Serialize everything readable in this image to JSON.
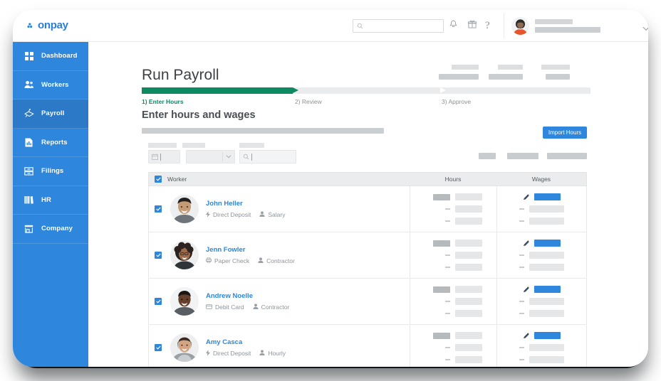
{
  "brand": {
    "name": "onpay",
    "color": "#2e86dd"
  },
  "topbar": {
    "search": {
      "placeholder": "",
      "value": ""
    },
    "icons": [
      {
        "name": "bell-icon",
        "label": "Notifications"
      },
      {
        "name": "gift-icon",
        "label": "What's New"
      },
      {
        "name": "help-icon",
        "label": "?"
      }
    ],
    "user_menu": {
      "caret": "chevron-down-icon"
    }
  },
  "sidebar": {
    "items": [
      {
        "label": "Dashboard",
        "icon": "grid-icon",
        "active": false
      },
      {
        "label": "Workers",
        "icon": "people-icon",
        "active": false
      },
      {
        "label": "Payroll",
        "icon": "money-icon",
        "active": true
      },
      {
        "label": "Reports",
        "icon": "document-icon",
        "active": false
      },
      {
        "label": "Filings",
        "icon": "drawer-icon",
        "active": false
      },
      {
        "label": "HR",
        "icon": "books-icon",
        "active": false
      },
      {
        "label": "Company",
        "icon": "store-icon",
        "active": false
      }
    ]
  },
  "main": {
    "title": "Run Payroll",
    "steps": [
      {
        "label": "1) Enter Hours",
        "state": "active"
      },
      {
        "label": "2) Review",
        "state": "upcoming"
      },
      {
        "label": "3) Approve",
        "state": "upcoming"
      }
    ],
    "progress_percent": 34,
    "progress_color": "#0d8a62",
    "section_title": "Enter hours and wages",
    "import_button": "Import Hours",
    "filters": {
      "date": {
        "icon": "calendar-icon",
        "value": ""
      },
      "select": {
        "value": "",
        "caret": "chevron-down-icon"
      },
      "search": {
        "icon": "search-icon",
        "value": ""
      }
    }
  },
  "table": {
    "columns": {
      "worker": "Worker",
      "hours": "Hours",
      "wages": "Wages"
    },
    "select_all_checked": true,
    "rows": [
      {
        "name": "John Heller",
        "pay_method": "Direct Deposit",
        "pay_method_icon": "lightning-icon",
        "pay_type": "Salary",
        "pay_type_icon": "person-icon",
        "selected": true,
        "avatar": "avatar-john"
      },
      {
        "name": "Jenn Fowler",
        "pay_method": "Paper Check",
        "pay_method_icon": "printer-icon",
        "pay_type": "Contractor",
        "pay_type_icon": "person-icon",
        "selected": true,
        "avatar": "avatar-jenn"
      },
      {
        "name": "Andrew Noelle",
        "pay_method": "Debit Card",
        "pay_method_icon": "card-icon",
        "pay_type": "Contractor",
        "pay_type_icon": "person-icon",
        "selected": true,
        "avatar": "avatar-andrew"
      },
      {
        "name": "Amy Casca",
        "pay_method": "Direct Deposit",
        "pay_method_icon": "lightning-icon",
        "pay_type": "Hourly",
        "pay_type_icon": "person-icon",
        "selected": true,
        "avatar": "avatar-amy"
      }
    ]
  }
}
